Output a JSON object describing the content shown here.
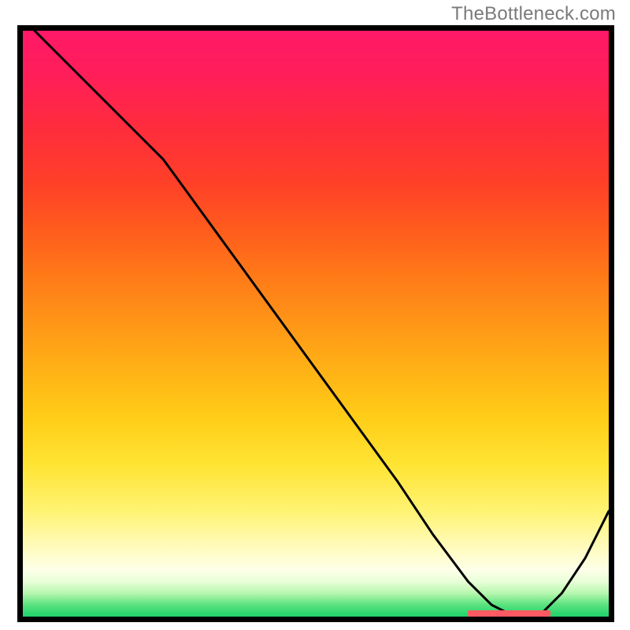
{
  "watermark": "TheBottleneck.com",
  "chart_data": {
    "type": "line",
    "title": "",
    "xlabel": "",
    "ylabel": "",
    "xlim": [
      0,
      100
    ],
    "ylim": [
      0,
      100
    ],
    "grid": false,
    "legend": false,
    "annotations": [],
    "background_gradient": {
      "direction": "top-to-bottom",
      "stops": [
        {
          "pos": 0.0,
          "color": "#ff1868"
        },
        {
          "pos": 0.08,
          "color": "#ff1f58"
        },
        {
          "pos": 0.16,
          "color": "#ff2b3e"
        },
        {
          "pos": 0.26,
          "color": "#ff4028"
        },
        {
          "pos": 0.34,
          "color": "#ff5c1d"
        },
        {
          "pos": 0.42,
          "color": "#ff7a18"
        },
        {
          "pos": 0.5,
          "color": "#ff9617"
        },
        {
          "pos": 0.58,
          "color": "#ffb216"
        },
        {
          "pos": 0.66,
          "color": "#ffcd17"
        },
        {
          "pos": 0.74,
          "color": "#ffe433"
        },
        {
          "pos": 0.82,
          "color": "#fff373"
        },
        {
          "pos": 0.89,
          "color": "#fffcc6"
        },
        {
          "pos": 0.92,
          "color": "#fdffe9"
        },
        {
          "pos": 0.94,
          "color": "#e8ffd8"
        },
        {
          "pos": 0.96,
          "color": "#b7f7af"
        },
        {
          "pos": 0.98,
          "color": "#59e27e"
        },
        {
          "pos": 1.0,
          "color": "#1fd36a"
        }
      ]
    },
    "series": [
      {
        "name": "curve",
        "color": "#000000",
        "stroke_width": 3,
        "x": [
          2,
          10,
          18,
          24,
          32,
          40,
          48,
          56,
          64,
          70,
          76,
          80,
          84,
          88,
          92,
          96,
          100
        ],
        "y": [
          100,
          92,
          84,
          78,
          67,
          56,
          45,
          34,
          23,
          14,
          6,
          2,
          0,
          0,
          4,
          10,
          18
        ]
      }
    ],
    "marker_strip": {
      "color": "#ff5a63",
      "x_start": 76,
      "x_end": 90,
      "y": 0,
      "height_frac": 0.011
    }
  }
}
